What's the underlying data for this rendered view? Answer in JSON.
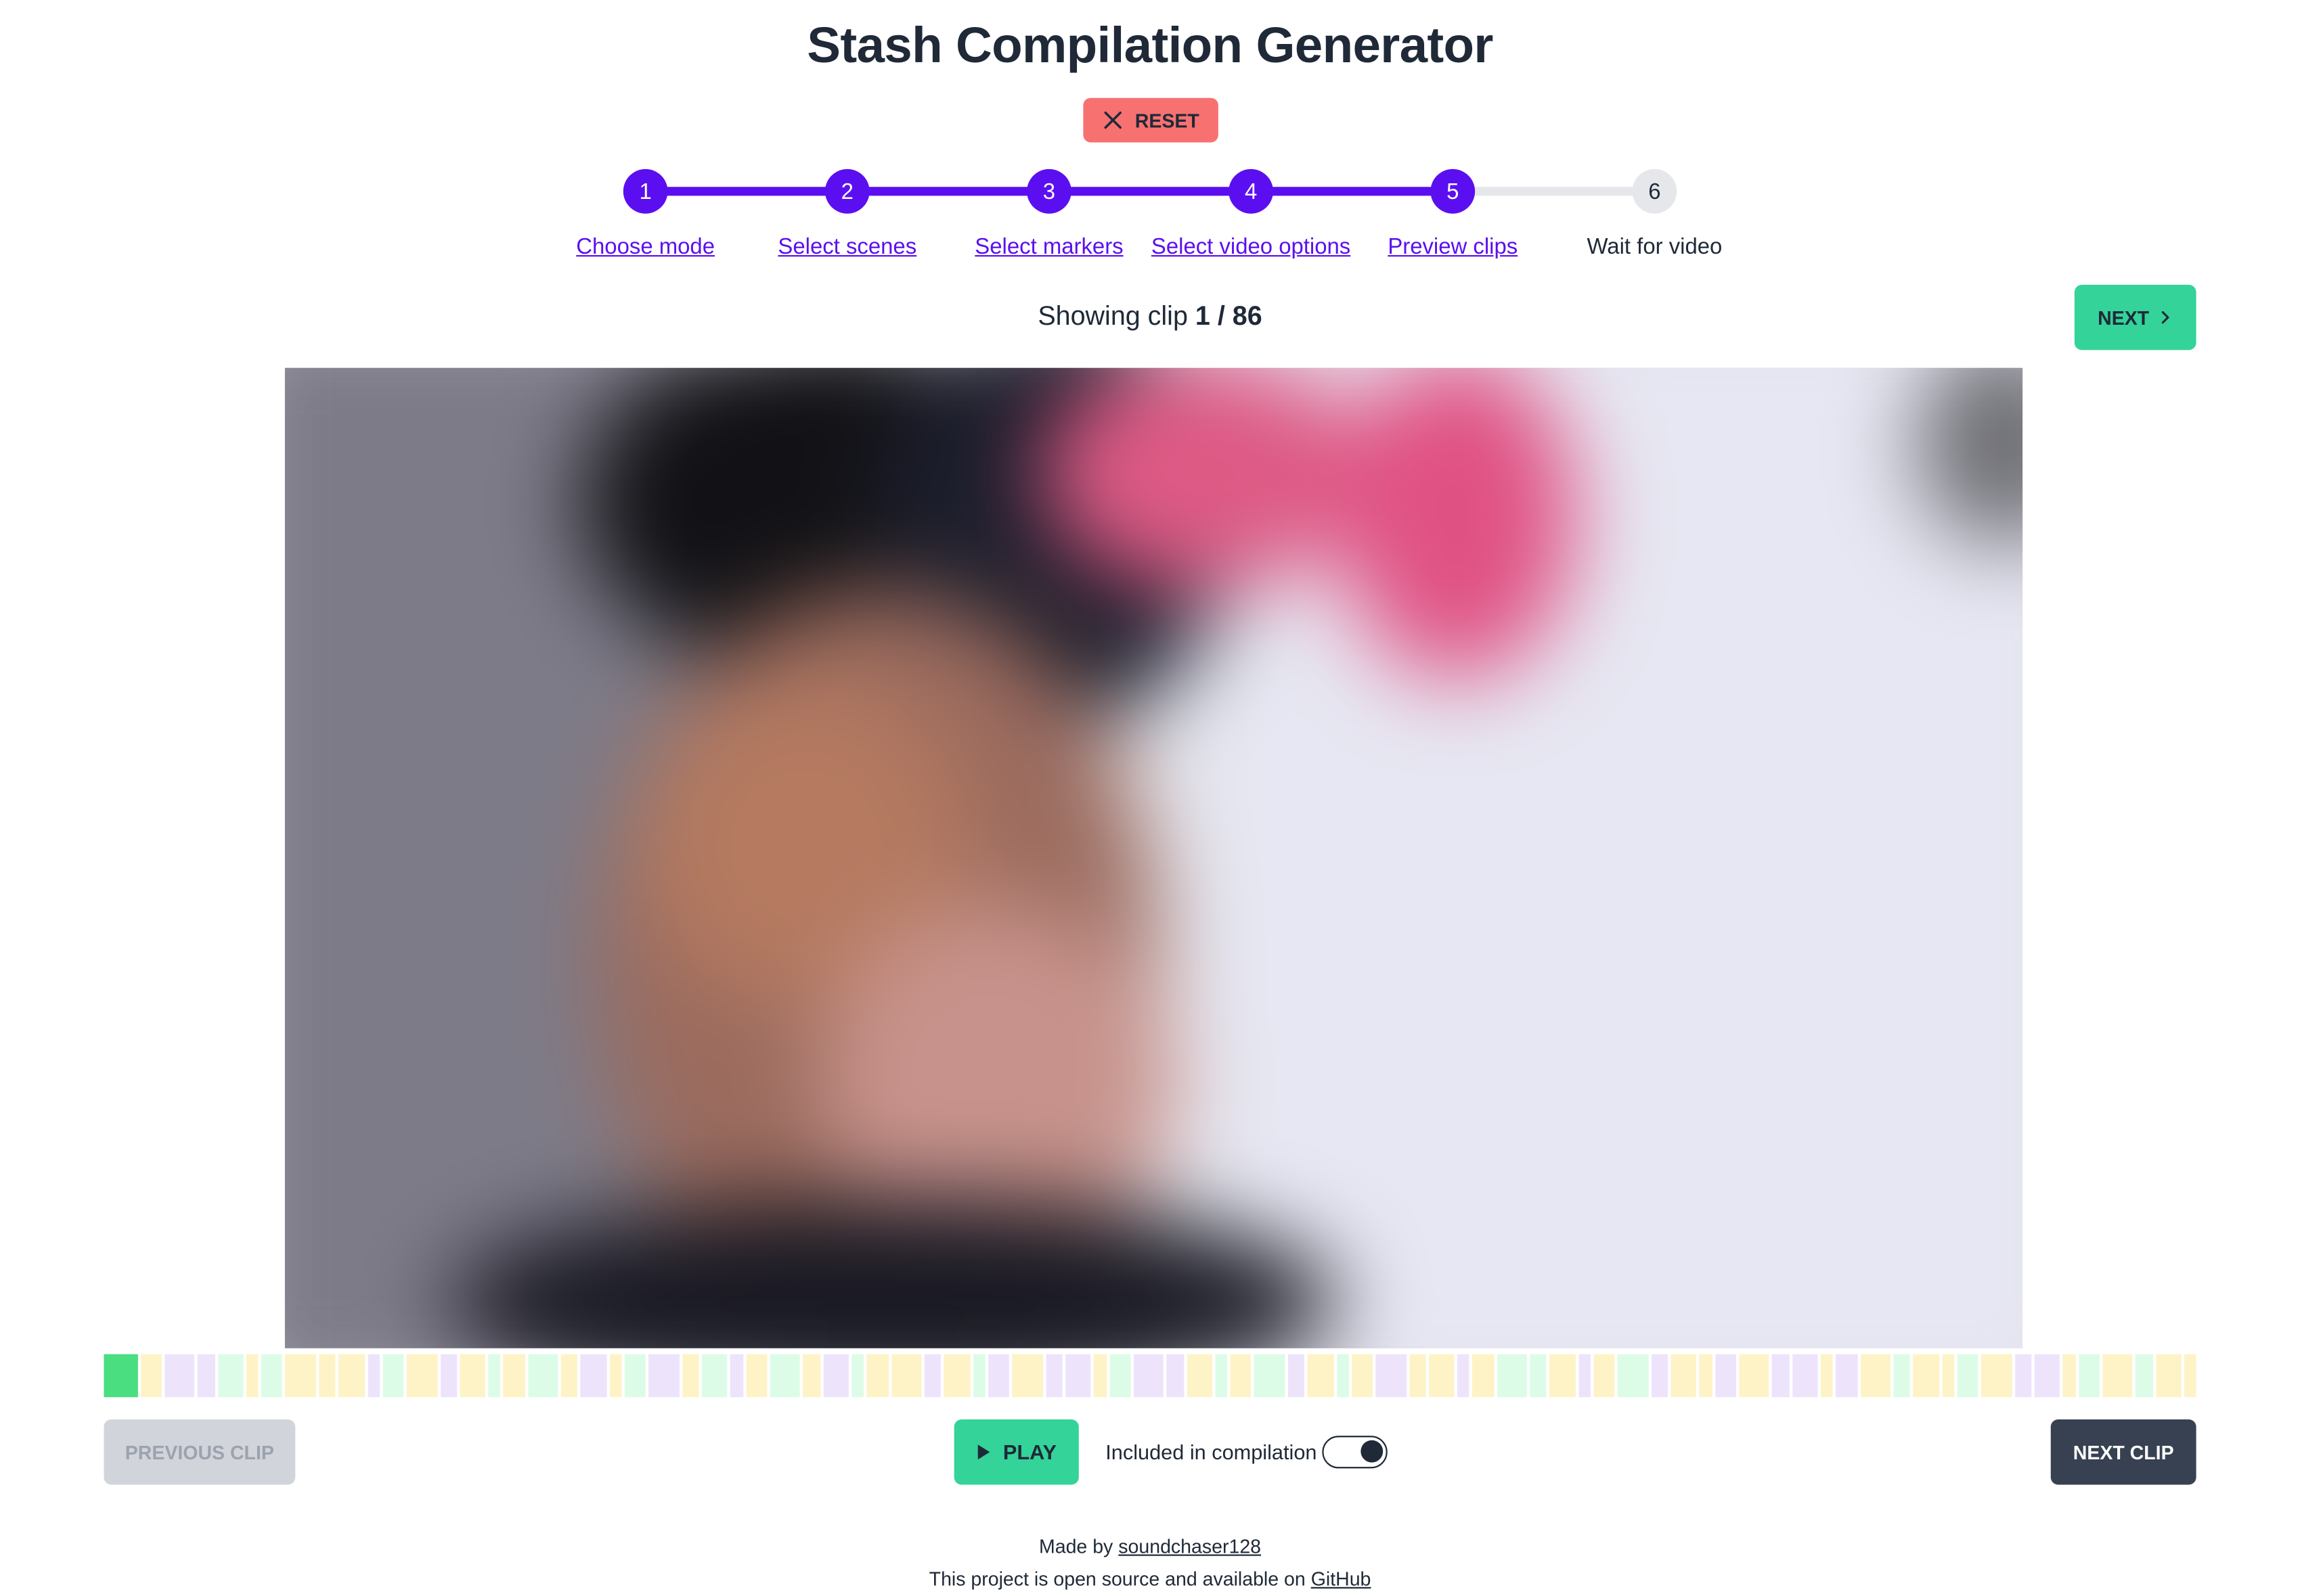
{
  "app": {
    "title": "Stash Compilation Generator",
    "reset_label": "RESET"
  },
  "stepper": {
    "steps": [
      {
        "number": "1",
        "label": "Choose mode",
        "state": "done"
      },
      {
        "number": "2",
        "label": "Select scenes",
        "state": "done"
      },
      {
        "number": "3",
        "label": "Select markers",
        "state": "done"
      },
      {
        "number": "4",
        "label": "Select video options",
        "state": "done"
      },
      {
        "number": "5",
        "label": "Preview clips",
        "state": "current"
      },
      {
        "number": "6",
        "label": "Wait for video",
        "state": "todo"
      }
    ]
  },
  "preview": {
    "showing_prefix": "Showing clip",
    "current": "1",
    "total": "86",
    "next_label": "NEXT"
  },
  "timeline": {
    "selected_index": 0,
    "colors": {
      "selected": "#4ade80",
      "yellow": "#fef3c7",
      "purple": "#ede4fc",
      "green": "#dcfce7"
    },
    "segments": [
      "selected",
      "yellow",
      "purple",
      "purple",
      "green",
      "yellow",
      "green",
      "yellow",
      "yellow",
      "yellow",
      "purple",
      "green",
      "yellow",
      "purple",
      "yellow",
      "green",
      "yellow",
      "green",
      "yellow",
      "purple",
      "yellow",
      "green",
      "purple",
      "yellow",
      "green",
      "purple",
      "yellow",
      "green",
      "yellow",
      "purple",
      "green",
      "yellow",
      "yellow",
      "purple",
      "yellow",
      "green",
      "purple",
      "yellow",
      "purple",
      "purple",
      "yellow",
      "green",
      "purple",
      "purple",
      "yellow",
      "green",
      "yellow",
      "green",
      "purple",
      "yellow",
      "green",
      "yellow",
      "purple",
      "yellow",
      "yellow",
      "purple",
      "yellow",
      "green",
      "green",
      "yellow",
      "purple",
      "yellow",
      "green",
      "purple",
      "yellow",
      "yellow",
      "purple",
      "yellow",
      "purple",
      "purple",
      "yellow",
      "purple",
      "yellow",
      "green",
      "yellow",
      "yellow",
      "green",
      "yellow",
      "purple",
      "purple",
      "yellow",
      "green",
      "yellow",
      "green",
      "yellow",
      "yellow"
    ]
  },
  "controls": {
    "previous_label": "PREVIOUS CLIP",
    "play_label": "PLAY",
    "include_label": "Included in compilation",
    "include_on": true,
    "next_clip_label": "NEXT CLIP"
  },
  "footer": {
    "made_by_prefix": "Made by",
    "author": "soundchaser128",
    "open_source_prefix": "This project is open source and available on",
    "github": "GitHub"
  },
  "theme": {
    "primary": "#5b0ff0",
    "success": "#34d399",
    "danger": "#f87171",
    "dark": "#374151"
  }
}
